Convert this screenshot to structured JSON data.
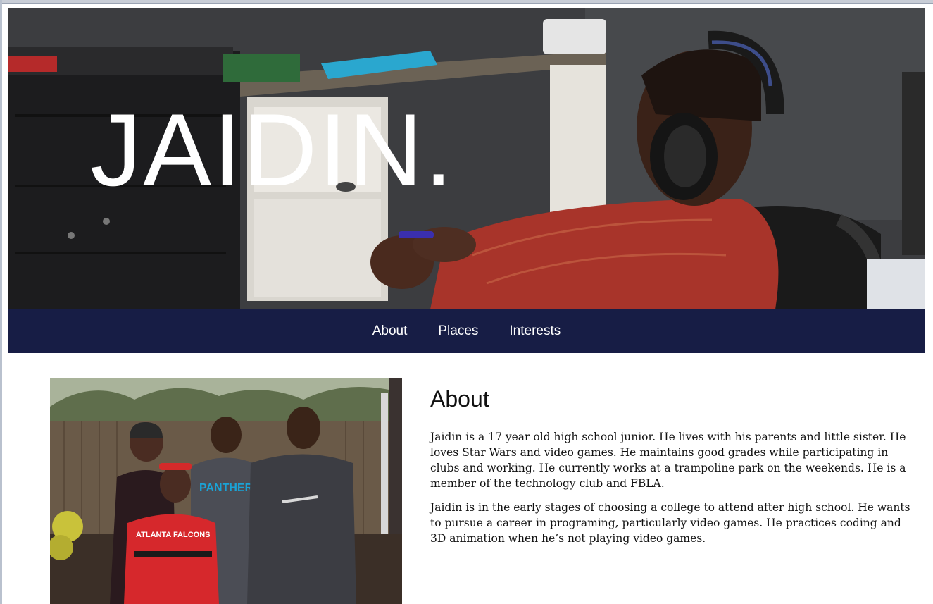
{
  "hero": {
    "title": "JAIDIN."
  },
  "nav": {
    "items": [
      {
        "label": "About"
      },
      {
        "label": "Places"
      },
      {
        "label": "Interests"
      }
    ]
  },
  "about": {
    "heading": "About",
    "paragraphs": [
      "Jaidin is a 17 year old high school junior. He lives with his parents and little sister. He loves Star Wars and video games. He maintains good grades while participating in clubs and working. He currently works at a trampoline park on the weekends. He is a member of the technology club and FBLA.",
      "Jaidin is in the early stages of choosing a college to attend after high school. He wants to pursue a career in programing, particularly video games. He practices coding and 3D animation when he’s not playing video games."
    ]
  },
  "colors": {
    "nav_background": "#171d45",
    "hero_title": "#ffffff"
  }
}
